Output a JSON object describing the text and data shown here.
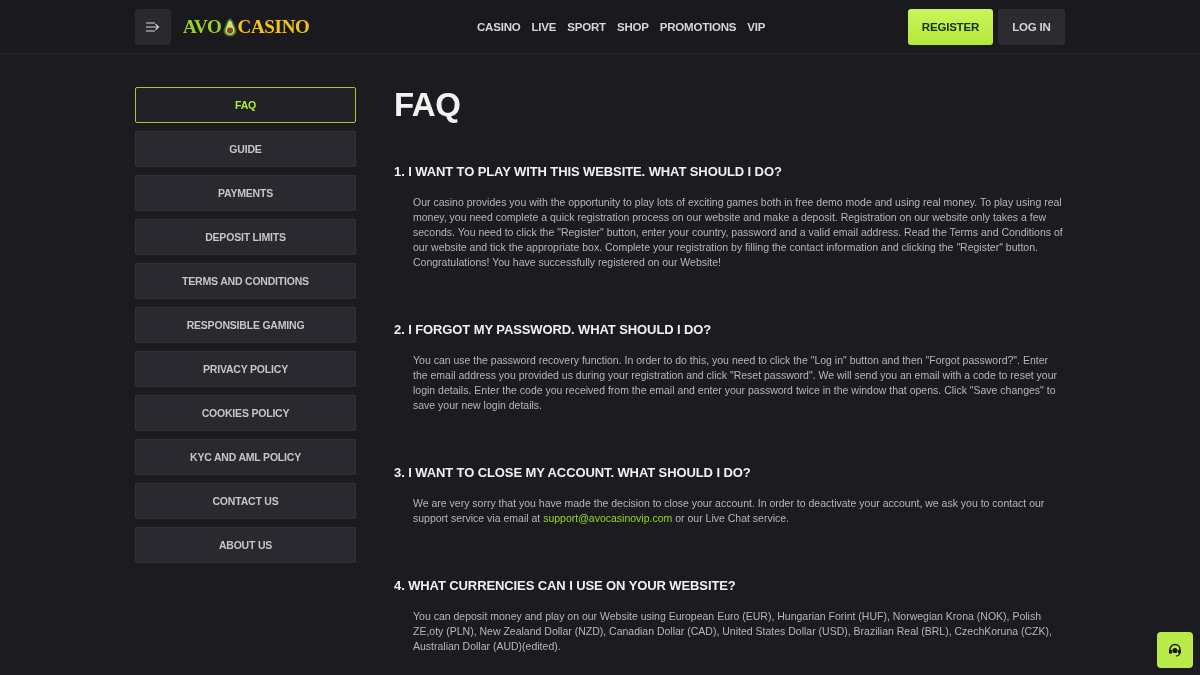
{
  "header": {
    "logo": {
      "part_1": "AVO",
      "part_2": "CASINO"
    },
    "nav": [
      "CASINO",
      "LIVE",
      "SPORT",
      "SHOP",
      "PROMOTIONS",
      "VIP"
    ],
    "buttons": [
      {
        "label": "REGISTER",
        "kind": "primary"
      },
      {
        "label": "LOG IN",
        "kind": "secondary"
      }
    ]
  },
  "sidebar": {
    "items": [
      {
        "label": "FAQ",
        "selected": true
      },
      {
        "label": "GUIDE",
        "selected": false
      },
      {
        "label": "PAYMENTS",
        "selected": false
      },
      {
        "label": "DEPOSIT LIMITS",
        "selected": false
      },
      {
        "label": "TERMS AND CONDITIONS",
        "selected": false
      },
      {
        "label": "RESPONSIBLE GAMING",
        "selected": false
      },
      {
        "label": "PRIVACY POLICY",
        "selected": false
      },
      {
        "label": "COOKIES POLICY",
        "selected": false
      },
      {
        "label": "KYC AND AML POLICY",
        "selected": false
      },
      {
        "label": "CONTACT US",
        "selected": false
      },
      {
        "label": "ABOUT US",
        "selected": false
      }
    ]
  },
  "content": {
    "title": "FAQ",
    "sections": [
      {
        "question": "1. I WANT TO PLAY WITH THIS WEBSITE. WHAT SHOULD I DO?",
        "answer": [
          {
            "kind": "text",
            "text": "Our casino provides you with the opportunity to play lots of exciting games both in free demo mode and using real money. To play using real money, you need complete a quick registration process on our website and make a deposit. Registration on our website only takes a few seconds. You need to click the \"Register\" button, enter your country, password and a valid email address. Read the Terms and Conditions of our website and tick the appropriate box. Complete your registration by filling the contact information and clicking the \"Register\" button. Congratulations! You have successfully registered on our Website!"
          }
        ]
      },
      {
        "question": "2. I FORGOT MY PASSWORD. WHAT SHOULD I DO?",
        "answer": [
          {
            "kind": "text",
            "text": "You can use the password recovery function. In order to do this, you need to click the \"Log in\" button and then \"Forgot password?\". Enter the email address you provided us during your registration and click \"Reset password\". We will send you an email with a code to reset your login details. Enter the code you received from the email and enter your password twice in the window that opens. Click \"Save changes\" to save your new login details."
          }
        ]
      },
      {
        "question": "3. I WANT TO CLOSE MY ACCOUNT. WHAT SHOULD I DO?",
        "answer": [
          {
            "kind": "text",
            "text": "We are very sorry that you have made the decision to close your account. In order to deactivate your account, we ask you to contact our support service via email at "
          },
          {
            "kind": "link",
            "text": "support@avocasinovip.com"
          },
          {
            "kind": "text",
            "text": " or our Live Chat service."
          }
        ]
      },
      {
        "question": "4. WHAT CURRENCIES CAN I USE ON YOUR WEBSITE?",
        "answer": [
          {
            "kind": "text",
            "text": "You can deposit money and play on our Website using European Euro (EUR), Hungarian Forint (HUF), Norwegian Krona (NOK), Polish ZE,oty (PLN), New Zealand Dollar (NZD), Canadian Dollar (CAD), United States Dollar (USD), Brazilian Real (BRL), CzechKoruna (CZK), Australian Dollar (AUD)(edited)."
          }
        ]
      }
    ]
  }
}
